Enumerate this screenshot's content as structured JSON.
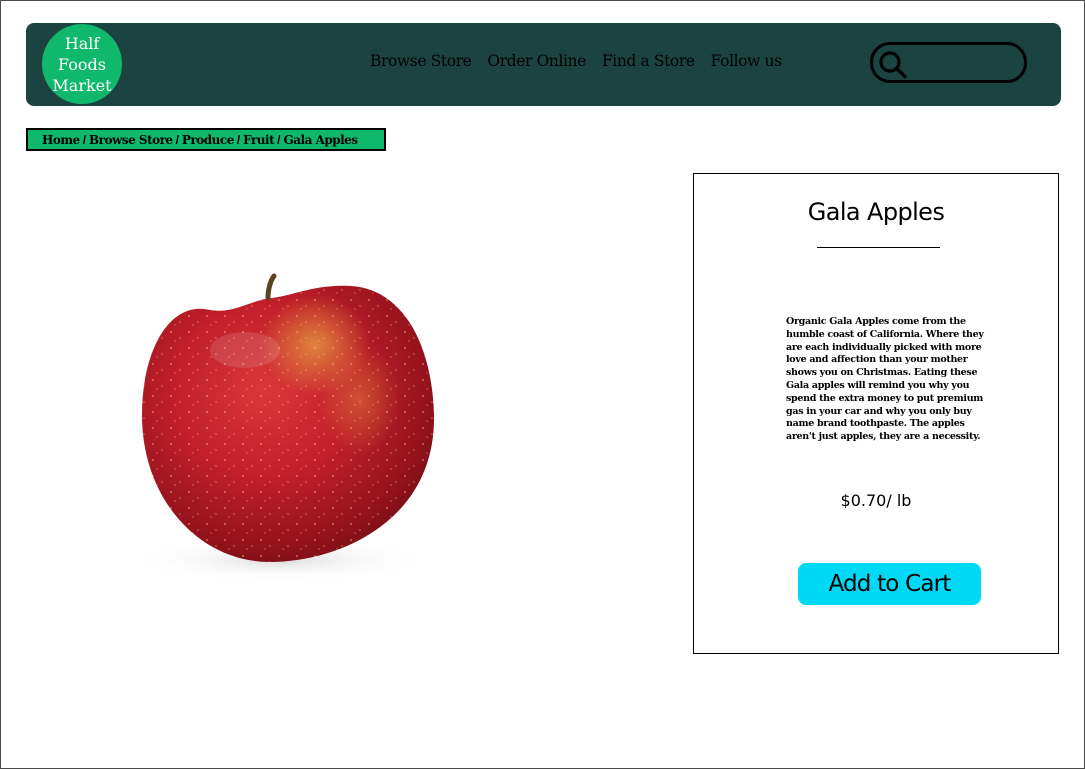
{
  "header": {
    "logo_lines": [
      "Half",
      "Foods",
      "Market"
    ],
    "nav": [
      "Browse Store",
      "Order Online",
      "Find a Store",
      "Follow us"
    ],
    "search": {
      "placeholder": "",
      "value": "",
      "icon": "search-icon"
    }
  },
  "breadcrumb": [
    "Home",
    "Browse Store",
    "Produce",
    "Fruit",
    "Gala Apples"
  ],
  "product": {
    "image_alt": "red gala apple",
    "title": "Gala Apples",
    "description": "Organic Gala Apples come from the humble coast of California. Where they are each individually picked with more love and affection than your mother shows you on Christmas. Eating these Gala apples will remind you why you spend the extra money to put premium gas in your car and why you only buy name brand toothpaste. The apples aren't just apples, they are a necessity.",
    "price": "$0.70/ lb",
    "add_to_cart_label": "Add to Cart"
  },
  "colors": {
    "header_bg": "#1b4441",
    "logo_bg": "#0fb86b",
    "breadcrumb_bg": "#0fb86b",
    "button_bg": "#00d9f5"
  }
}
